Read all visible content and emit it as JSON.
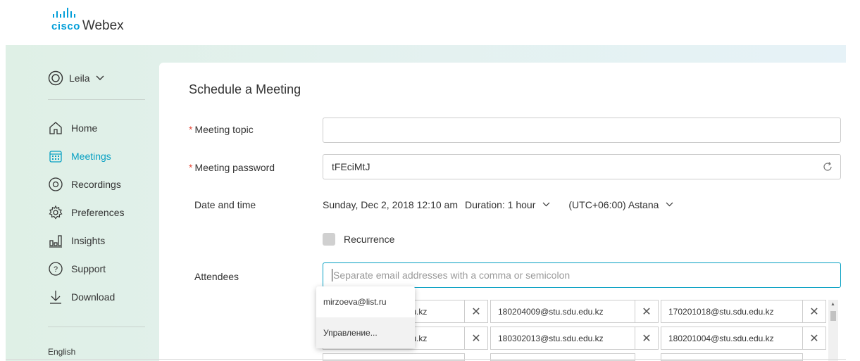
{
  "brand": {
    "cisco": "cisco",
    "webex": "Webex",
    "color": "#049fd9"
  },
  "sidebar": {
    "user": "Leila",
    "items": [
      {
        "label": "Home",
        "icon": "home-icon",
        "active": false
      },
      {
        "label": "Meetings",
        "icon": "calendar-icon",
        "active": true
      },
      {
        "label": "Recordings",
        "icon": "record-icon",
        "active": false
      },
      {
        "label": "Preferences",
        "icon": "gear-icon",
        "active": false
      },
      {
        "label": "Insights",
        "icon": "bar-chart-icon",
        "active": false
      },
      {
        "label": "Support",
        "icon": "question-icon",
        "active": false
      },
      {
        "label": "Download",
        "icon": "download-icon",
        "active": false
      }
    ],
    "language": "English"
  },
  "form": {
    "title": "Schedule a Meeting",
    "topic_label": "Meeting topic",
    "topic_value": "",
    "password_label": "Meeting password",
    "password_value": "tFEciMtJ",
    "datetime_label": "Date and time",
    "date": "Sunday, Dec 2, 2018 12:10 am",
    "duration": "Duration: 1 hour",
    "timezone": "(UTC+06:00) Astana",
    "recurrence_label": "Recurrence",
    "attendees_label": "Attendees",
    "attendees_placeholder": "Separate email addresses with a comma or semicolon",
    "required_mark": "*"
  },
  "attendees": [
    [
      "edu.kz",
      "180204009@stu.sdu.edu.kz",
      "170201018@stu.sdu.edu.kz"
    ],
    [
      "edu.kz",
      "180302013@stu.sdu.edu.kz",
      "180201004@stu.sdu.edu.kz"
    ]
  ],
  "autocomplete": {
    "items": [
      "mirzoeva@list.ru",
      "Управление..."
    ]
  },
  "accent": "#07a0c3"
}
